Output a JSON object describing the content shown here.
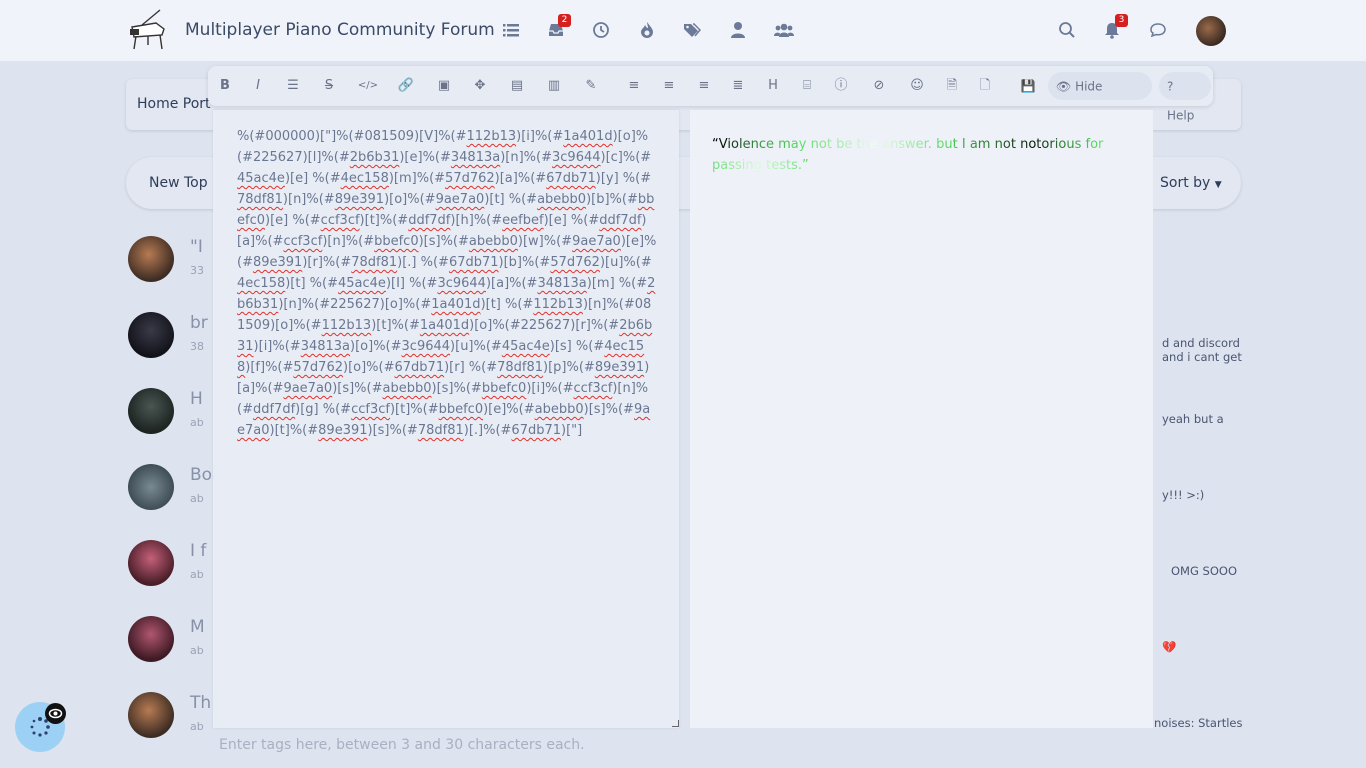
{
  "header": {
    "site_title": "Multiplayer Piano Community Forum",
    "nav_icons": [
      "list-icon",
      "inbox-icon",
      "clock-icon",
      "fire-icon",
      "tags-icon",
      "user-icon",
      "users-icon"
    ],
    "inbox_badge": "2",
    "right_icons": [
      "search-icon",
      "bell-icon",
      "chat-icon"
    ],
    "notifications_badge": "3"
  },
  "breadcrumb": {
    "text": "Home Port"
  },
  "topics_bar": {
    "new_topic": "New Top",
    "sort_by": "Sort by"
  },
  "topic_rows": [
    {
      "title": "\"I",
      "meta": "33"
    },
    {
      "title": "br",
      "meta": "38"
    },
    {
      "title": "H",
      "meta": "ab"
    },
    {
      "title": "Bo",
      "meta": "ab"
    },
    {
      "title": "I f",
      "meta": "ab"
    },
    {
      "title": "M",
      "meta": "ab"
    },
    {
      "title": "Th",
      "meta": "ab"
    }
  ],
  "right_snippets": [
    "d and discord and i cant get",
    "yeah but a",
    "y!!! >:)",
    "OMG SOOO",
    "💔",
    "noises: Startles"
  ],
  "toolbar": {
    "buttons": [
      "bold-icon",
      "italic-icon",
      "list-icon",
      "strikethrough-icon",
      "code-icon",
      "link-icon",
      "image-icon",
      "expand-icon",
      "id-card-icon",
      "chart-icon",
      "pen-icon",
      "align-left-icon",
      "align-center-icon",
      "align-right-icon",
      "align-justify-icon",
      "heading-icon",
      "file-code-icon",
      "info-icon",
      "eye-slash-icon",
      "smile-icon",
      "file-alt-icon",
      "file-icon",
      "save-icon"
    ],
    "hide_preview_label": "Hide Preview",
    "help_label": "Help"
  },
  "editor": {
    "segments": [
      [
        "%(#000000)[\"]%(#081509)[V]%(#",
        false
      ],
      [
        "112b13",
        true
      ],
      [
        ")[i]%(#",
        false
      ],
      [
        "1a401d",
        true
      ],
      [
        ")[o]%(#",
        false
      ],
      [
        "225627",
        false
      ],
      [
        ")[l]%(#",
        false
      ],
      [
        "2b6b31",
        true
      ],
      [
        ")[e]%(#",
        false
      ],
      [
        "34813a",
        true
      ],
      [
        ")[n]%(#",
        false
      ],
      [
        "3c9644",
        true
      ],
      [
        ")[c]%(#",
        false
      ],
      [
        "45ac4e",
        true
      ],
      [
        ")[e] %(#",
        false
      ],
      [
        "4ec158",
        true
      ],
      [
        ")[m]%(#",
        false
      ],
      [
        "57d762",
        true
      ],
      [
        ")[a]%(#",
        false
      ],
      [
        "67db71",
        true
      ],
      [
        ")[y] %(#",
        false
      ],
      [
        "78df81",
        true
      ],
      [
        ")[n]%(#",
        false
      ],
      [
        "89e391",
        true
      ],
      [
        ")[o]%(#",
        false
      ],
      [
        "9ae7a0",
        true
      ],
      [
        ")[t] %(#",
        false
      ],
      [
        "abebb0",
        true
      ],
      [
        ")[b]%(#",
        false
      ],
      [
        "bbefc0",
        true
      ],
      [
        ")[e] %(#",
        false
      ],
      [
        "ccf3cf",
        true
      ],
      [
        ")[t]%(#",
        false
      ],
      [
        "ddf7df",
        true
      ],
      [
        ")[h]%(#",
        false
      ],
      [
        "eefbef",
        true
      ],
      [
        ")[e] %(#",
        false
      ],
      [
        "ddf7df",
        true
      ],
      [
        ")[a]%(#",
        false
      ],
      [
        "ccf3cf",
        true
      ],
      [
        ")[n]%(#",
        false
      ],
      [
        "bbefc0",
        true
      ],
      [
        ")[s]%(#",
        false
      ],
      [
        "abebb0",
        true
      ],
      [
        ")[w]%(#",
        false
      ],
      [
        "9ae7a0",
        true
      ],
      [
        ")[e]%(#",
        false
      ],
      [
        "89e391",
        true
      ],
      [
        ")[r]%(#",
        false
      ],
      [
        "78df81",
        true
      ],
      [
        ")[.] %(#",
        false
      ],
      [
        "67db71",
        true
      ],
      [
        ")[b]%(#",
        false
      ],
      [
        "57d762",
        true
      ],
      [
        ")[u]%(#",
        false
      ],
      [
        "4ec158",
        true
      ],
      [
        ")[t] %(#",
        false
      ],
      [
        "45ac4e",
        true
      ],
      [
        ")[I] %(#",
        false
      ],
      [
        "3c9644",
        true
      ],
      [
        ")[a]%(#",
        false
      ],
      [
        "34813a",
        true
      ],
      [
        ")[m] %(#",
        false
      ],
      [
        "2b6b31",
        true
      ],
      [
        ")[n]%(#",
        false
      ],
      [
        "225627",
        false
      ],
      [
        ")[o]%(#",
        false
      ],
      [
        "1a401d",
        true
      ],
      [
        ")[t] %(#",
        false
      ],
      [
        "112b13",
        true
      ],
      [
        ")[n]%(#",
        false
      ],
      [
        "081509",
        false
      ],
      [
        ")[o]%(#",
        false
      ],
      [
        "112b13",
        true
      ],
      [
        ")[t]%(#",
        false
      ],
      [
        "1a401d",
        true
      ],
      [
        ")[o]%(#",
        false
      ],
      [
        "225627",
        false
      ],
      [
        ")[r]%(#",
        false
      ],
      [
        "2b6b31",
        true
      ],
      [
        ")[i]%(#",
        false
      ],
      [
        "34813a",
        true
      ],
      [
        ")[o]%(#",
        false
      ],
      [
        "3c9644",
        true
      ],
      [
        ")[u]%(#",
        false
      ],
      [
        "45ac4e",
        true
      ],
      [
        ")[s] %(#",
        false
      ],
      [
        "4ec158",
        true
      ],
      [
        ")[f]%(#",
        false
      ],
      [
        "57d762",
        true
      ],
      [
        ")[o]%(#",
        false
      ],
      [
        "67db71",
        true
      ],
      [
        ")[r] %(#",
        false
      ],
      [
        "78df81",
        true
      ],
      [
        ")[p]%(#",
        false
      ],
      [
        "89e391",
        true
      ],
      [
        ")[a]%(#",
        false
      ],
      [
        "9ae7a0",
        true
      ],
      [
        ")[s]%(#",
        false
      ],
      [
        "abebb0",
        true
      ],
      [
        ")[s]%(#",
        false
      ],
      [
        "bbefc0",
        true
      ],
      [
        ")[i]%(#",
        false
      ],
      [
        "ccf3cf",
        true
      ],
      [
        ")[n]%(#",
        false
      ],
      [
        "ddf7df",
        true
      ],
      [
        ")[g] %(#",
        false
      ],
      [
        "ccf3cf",
        true
      ],
      [
        ")[t]%(#",
        false
      ],
      [
        "bbefc0",
        true
      ],
      [
        ")[e]%(#",
        false
      ],
      [
        "abebb0",
        true
      ],
      [
        ")[s]%(#",
        false
      ],
      [
        "9ae7a0",
        true
      ],
      [
        ")[t]%(#",
        false
      ],
      [
        "89e391",
        true
      ],
      [
        ")[s]%(#",
        false
      ],
      [
        "78df81",
        true
      ],
      [
        ")[.]%(#",
        false
      ],
      [
        "67db71",
        true
      ],
      [
        ")[\"]",
        false
      ]
    ]
  },
  "preview": {
    "chars": [
      [
        "“",
        "#000000"
      ],
      [
        "V",
        "#081509"
      ],
      [
        "i",
        "#112b13"
      ],
      [
        "o",
        "#1a401d"
      ],
      [
        "l",
        "#225627"
      ],
      [
        "e",
        "#2b6b31"
      ],
      [
        "n",
        "#34813a"
      ],
      [
        "c",
        "#3c9644"
      ],
      [
        "e",
        "#45ac4e"
      ],
      [
        " ",
        "#45ac4e"
      ],
      [
        "m",
        "#4ec158"
      ],
      [
        "a",
        "#57d762"
      ],
      [
        "y",
        "#67db71"
      ],
      [
        " ",
        "#67db71"
      ],
      [
        "n",
        "#78df81"
      ],
      [
        "o",
        "#89e391"
      ],
      [
        "t",
        "#9ae7a0"
      ],
      [
        " ",
        "#9ae7a0"
      ],
      [
        "b",
        "#abebb0"
      ],
      [
        "e",
        "#bbefc0"
      ],
      [
        " ",
        "#bbefc0"
      ],
      [
        "t",
        "#ccf3cf"
      ],
      [
        "h",
        "#ddf7df"
      ],
      [
        "e",
        "#eefbef"
      ],
      [
        " ",
        "#eefbef"
      ],
      [
        "a",
        "#ddf7df"
      ],
      [
        "n",
        "#ccf3cf"
      ],
      [
        "s",
        "#bbefc0"
      ],
      [
        "w",
        "#abebb0"
      ],
      [
        "e",
        "#9ae7a0"
      ],
      [
        "r",
        "#89e391"
      ],
      [
        ".",
        "#78df81"
      ],
      [
        " ",
        "#78df81"
      ],
      [
        "b",
        "#67db71"
      ],
      [
        "u",
        "#57d762"
      ],
      [
        "t",
        "#4ec158"
      ],
      [
        " ",
        "#4ec158"
      ],
      [
        "I",
        "#45ac4e"
      ],
      [
        " ",
        "#45ac4e"
      ],
      [
        "a",
        "#3c9644"
      ],
      [
        "m",
        "#34813a"
      ],
      [
        " ",
        "#34813a"
      ],
      [
        "n",
        "#2b6b31"
      ],
      [
        "o",
        "#225627"
      ],
      [
        "t",
        "#1a401d"
      ],
      [
        " ",
        "#1a401d"
      ],
      [
        "n",
        "#112b13"
      ],
      [
        "o",
        "#081509"
      ],
      [
        "t",
        "#112b13"
      ],
      [
        "o",
        "#1a401d"
      ],
      [
        "r",
        "#225627"
      ],
      [
        "i",
        "#2b6b31"
      ],
      [
        "o",
        "#34813a"
      ],
      [
        "u",
        "#3c9644"
      ],
      [
        "s",
        "#45ac4e"
      ],
      [
        " ",
        "#45ac4e"
      ],
      [
        "f",
        "#4ec158"
      ],
      [
        "o",
        "#57d762"
      ],
      [
        "r",
        "#67db71"
      ],
      [
        " ",
        "#67db71"
      ],
      [
        "p",
        "#78df81"
      ],
      [
        "a",
        "#89e391"
      ],
      [
        "s",
        "#9ae7a0"
      ],
      [
        "s",
        "#abebb0"
      ],
      [
        "i",
        "#bbefc0"
      ],
      [
        "n",
        "#ccf3cf"
      ],
      [
        "g",
        "#ddf7df"
      ],
      [
        " ",
        "#ddf7df"
      ],
      [
        "t",
        "#ccf3cf"
      ],
      [
        "e",
        "#bbefc0"
      ],
      [
        "s",
        "#abebb0"
      ],
      [
        "t",
        "#9ae7a0"
      ],
      [
        "s",
        "#89e391"
      ],
      [
        ".",
        "#78df81"
      ],
      [
        "”",
        "#67db71"
      ]
    ]
  },
  "tags_input": {
    "placeholder": "Enter tags here, between 3 and 30 characters each."
  },
  "colors": {
    "accent": "#4a5a7a",
    "badge": "#d62020",
    "fab": "#9dd0f5",
    "save": "#2fb344"
  }
}
